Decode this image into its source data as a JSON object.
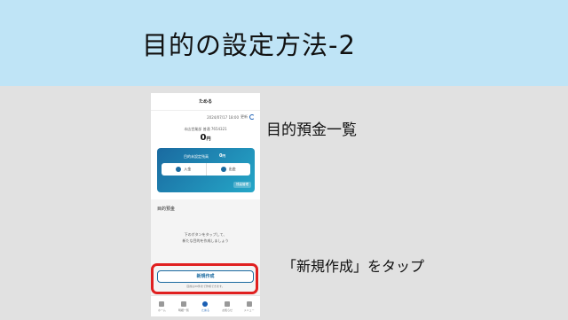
{
  "slide": {
    "title": "目的の設定方法-2",
    "annotation_list": "目的預金一覧",
    "annotation_tap": "「新規作成」をタップ",
    "colors": {
      "title_bg": "#bfe4f6",
      "highlight": "#e02020",
      "accent": "#1a6aa0"
    }
  },
  "app": {
    "header": "ためる",
    "datetime": "2024/07/17 18:00",
    "refresh_label": "更新",
    "account": "本店営業部 普通 7654321",
    "balance": "0",
    "balance_unit": "円",
    "unset_card": {
      "label": "目的未設定残高",
      "amount": "0",
      "amount_unit": "円",
      "deposit": "入金",
      "withdraw": "出金",
      "manage": "残高管理"
    },
    "section_title": "目的預金",
    "empty_line1": "下のボタンをタップして、",
    "empty_line2": "新たな目的を作成しましょう",
    "new_button": "新規作成",
    "note": "目的は20件まで作成できます。",
    "nav": [
      {
        "label": "ホーム",
        "icon": "home-icon"
      },
      {
        "label": "明細一覧",
        "icon": "list-icon"
      },
      {
        "label": "ためる",
        "icon": "piggy-bank-icon"
      },
      {
        "label": "お知らせ",
        "icon": "mail-icon"
      },
      {
        "label": "メニュー",
        "icon": "menu-icon"
      }
    ]
  }
}
